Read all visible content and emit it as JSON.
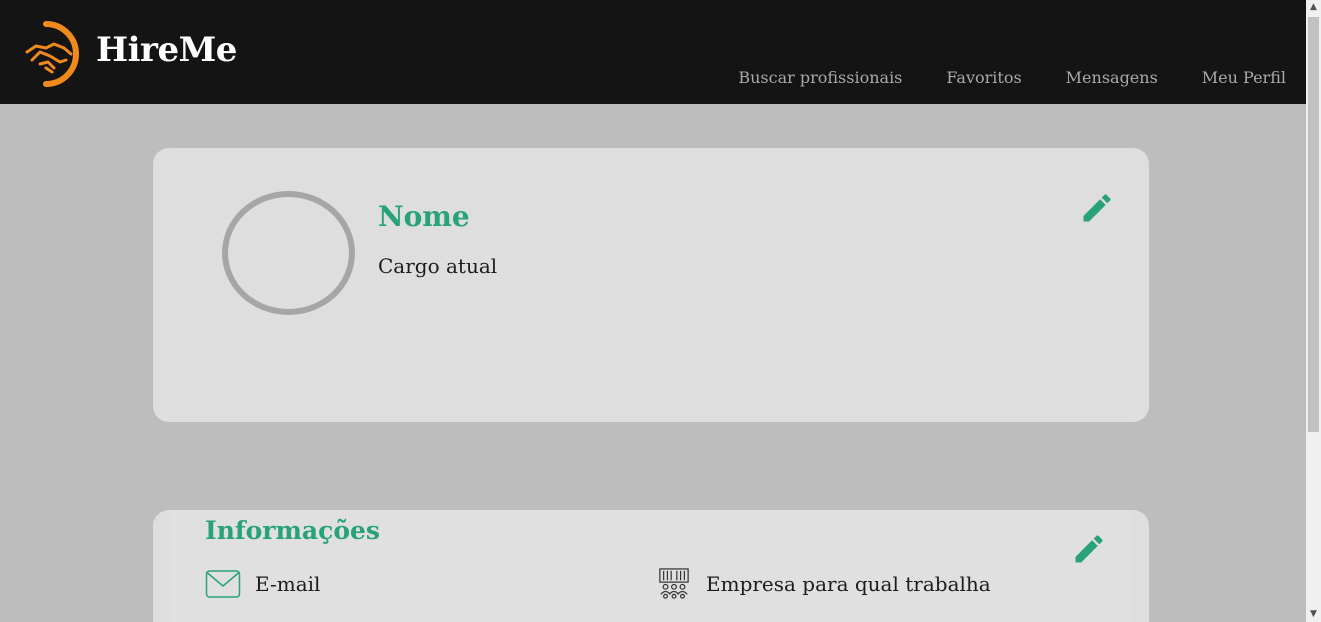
{
  "header": {
    "brand": "HireMe",
    "nav": [
      "Buscar profissionais",
      "Favoritos",
      "Mensagens",
      "Meu Perfil"
    ]
  },
  "profile": {
    "name": "Nome",
    "role": "Cargo atual"
  },
  "info": {
    "title": "Informações",
    "email_label": "E-mail",
    "company_label": "Empresa para qual trabalha"
  },
  "icons": {
    "logo": "handshake-icon",
    "edit": "pencil-icon",
    "email": "envelope-icon",
    "company": "company-building-icon"
  },
  "colors": {
    "accent": "#27a27a",
    "logo": "#f08a1c",
    "header_bg": "#141414",
    "page_bg": "#bdbdbd",
    "card_bg": "#dedede"
  }
}
